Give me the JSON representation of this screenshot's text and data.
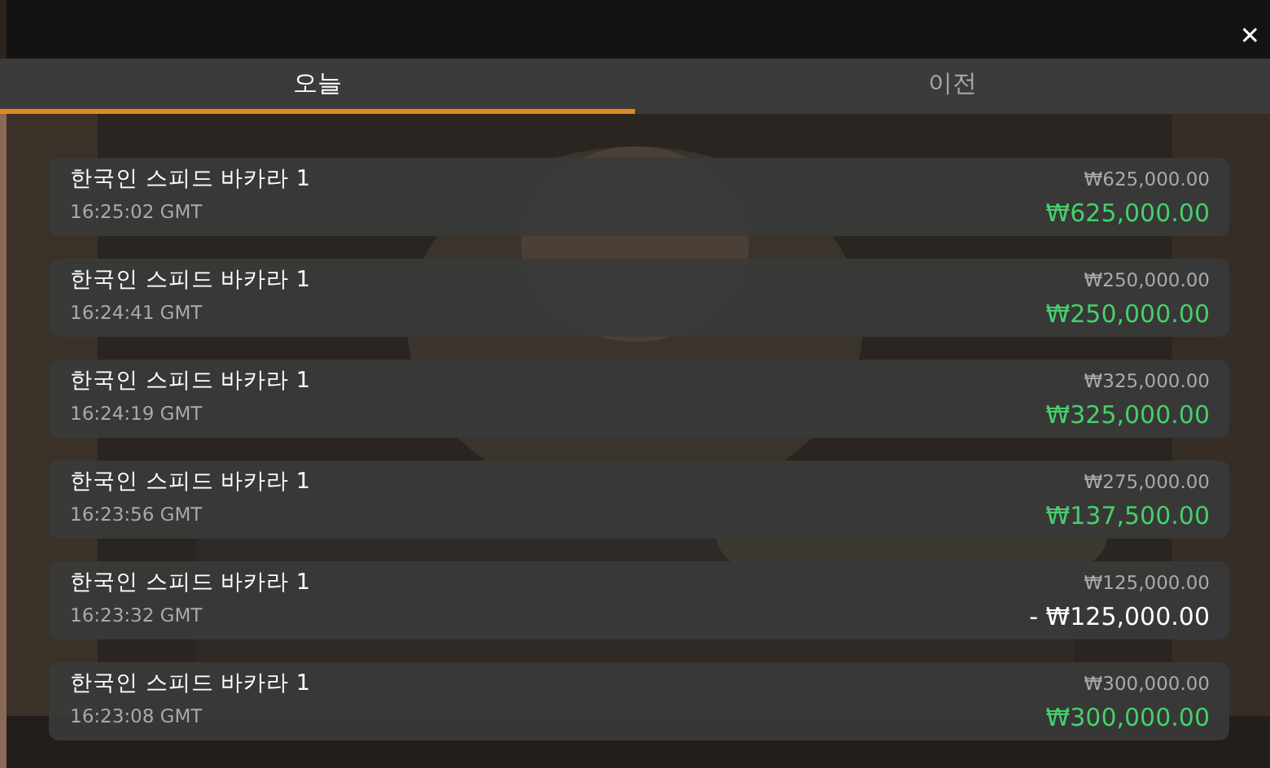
{
  "close_button": "✕",
  "tabs": [
    {
      "label": "오늘",
      "selected": true
    },
    {
      "label": "이전",
      "selected": false
    }
  ],
  "bets": [
    {
      "game": "한국인 스피드 바카라 1",
      "time": "16:25:02 GMT",
      "stake": "₩625,000.00",
      "payout": "₩625,000.00",
      "kind": "win"
    },
    {
      "game": "한국인 스피드 바카라 1",
      "time": "16:24:41 GMT",
      "stake": "₩250,000.00",
      "payout": "₩250,000.00",
      "kind": "win"
    },
    {
      "game": "한국인 스피드 바카라 1",
      "time": "16:24:19 GMT",
      "stake": "₩325,000.00",
      "payout": "₩325,000.00",
      "kind": "win"
    },
    {
      "game": "한국인 스피드 바카라 1",
      "time": "16:23:56 GMT",
      "stake": "₩275,000.00",
      "payout": "₩137,500.00",
      "kind": "win"
    },
    {
      "game": "한국인 스피드 바카라 1",
      "time": "16:23:32 GMT",
      "stake": "₩125,000.00",
      "payout": "- ₩125,000.00",
      "kind": "loss"
    },
    {
      "game": "한국인 스피드 바카라 1",
      "time": "16:23:08 GMT",
      "stake": "₩300,000.00",
      "payout": "₩300,000.00",
      "kind": "win"
    }
  ]
}
